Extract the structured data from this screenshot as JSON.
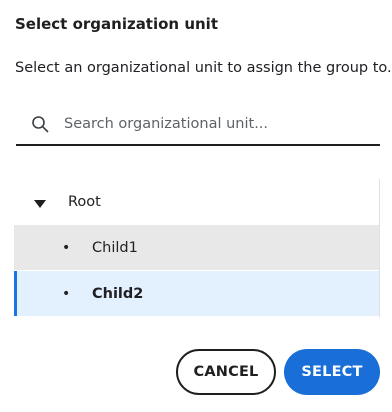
{
  "dialog": {
    "title": "Select organization unit",
    "description": "Select an organizational unit to assign the group to."
  },
  "search": {
    "placeholder": "Search organizational unit...",
    "value": "",
    "icon": "search-icon"
  },
  "tree": {
    "root": {
      "label": "Root",
      "expanded": true,
      "icon": "caret-down-icon"
    },
    "children": [
      {
        "label": "Child1",
        "state": "hovered",
        "bullet": "•"
      },
      {
        "label": "Child2",
        "state": "selected",
        "bullet": "•"
      }
    ]
  },
  "actions": {
    "cancel_label": "CANCEL",
    "select_label": "SELECT"
  },
  "colors": {
    "primary": "#1a6ed8",
    "selected_bg": "#e3f0fd",
    "hover_bg": "#e8e8e8"
  }
}
